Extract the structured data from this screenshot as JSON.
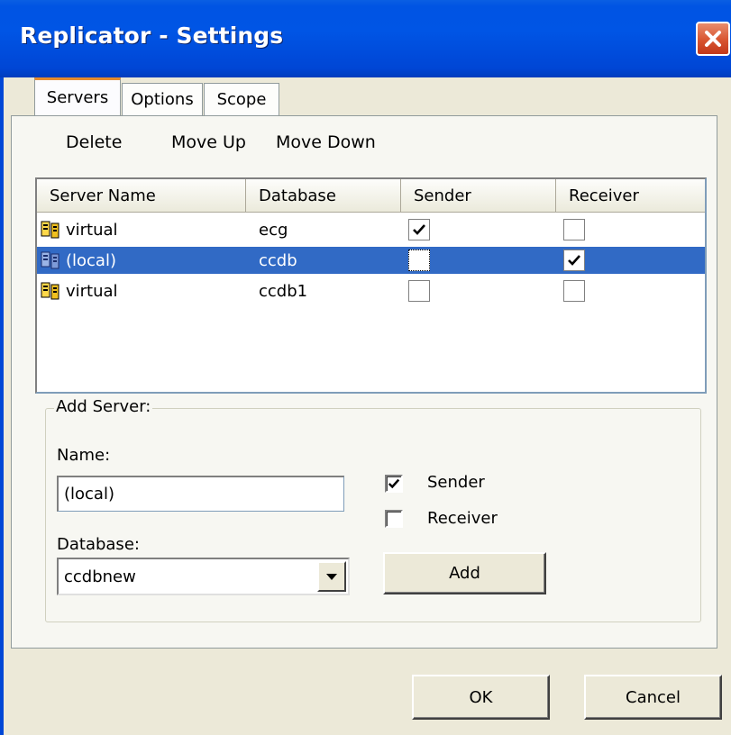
{
  "window": {
    "title": "Replicator - Settings"
  },
  "tabs": [
    {
      "label": "Servers",
      "active": true
    },
    {
      "label": "Options",
      "active": false
    },
    {
      "label": "Scope",
      "active": false
    }
  ],
  "toolbar": {
    "delete": "Delete",
    "move_up": "Move Up",
    "move_down": "Move Down"
  },
  "servers_table": {
    "columns": [
      "Server Name",
      "Database",
      "Sender",
      "Receiver"
    ],
    "rows": [
      {
        "server": "virtual",
        "database": "ecg",
        "sender": true,
        "receiver": false,
        "selected": false,
        "icon": "server-icon"
      },
      {
        "server": "(local)",
        "database": "ccdb",
        "sender": false,
        "receiver": true,
        "selected": true,
        "icon": "server-icon"
      },
      {
        "server": "virtual",
        "database": "ccdb1",
        "sender": false,
        "receiver": false,
        "selected": false,
        "icon": "server-icon"
      }
    ]
  },
  "add_server": {
    "legend": "Add Server:",
    "name_label": "Name:",
    "name_value": "(local)",
    "database_label": "Database:",
    "database_value": "ccdbnew",
    "sender_label": "Sender",
    "sender_checked": true,
    "receiver_label": "Receiver",
    "receiver_checked": false,
    "add_button": "Add"
  },
  "footer": {
    "ok": "OK",
    "cancel": "Cancel"
  },
  "colors": {
    "titlebar": "#0054e3",
    "selection": "#316ac5",
    "dialog_bg": "#ece9d8",
    "close": "#d8542f"
  }
}
